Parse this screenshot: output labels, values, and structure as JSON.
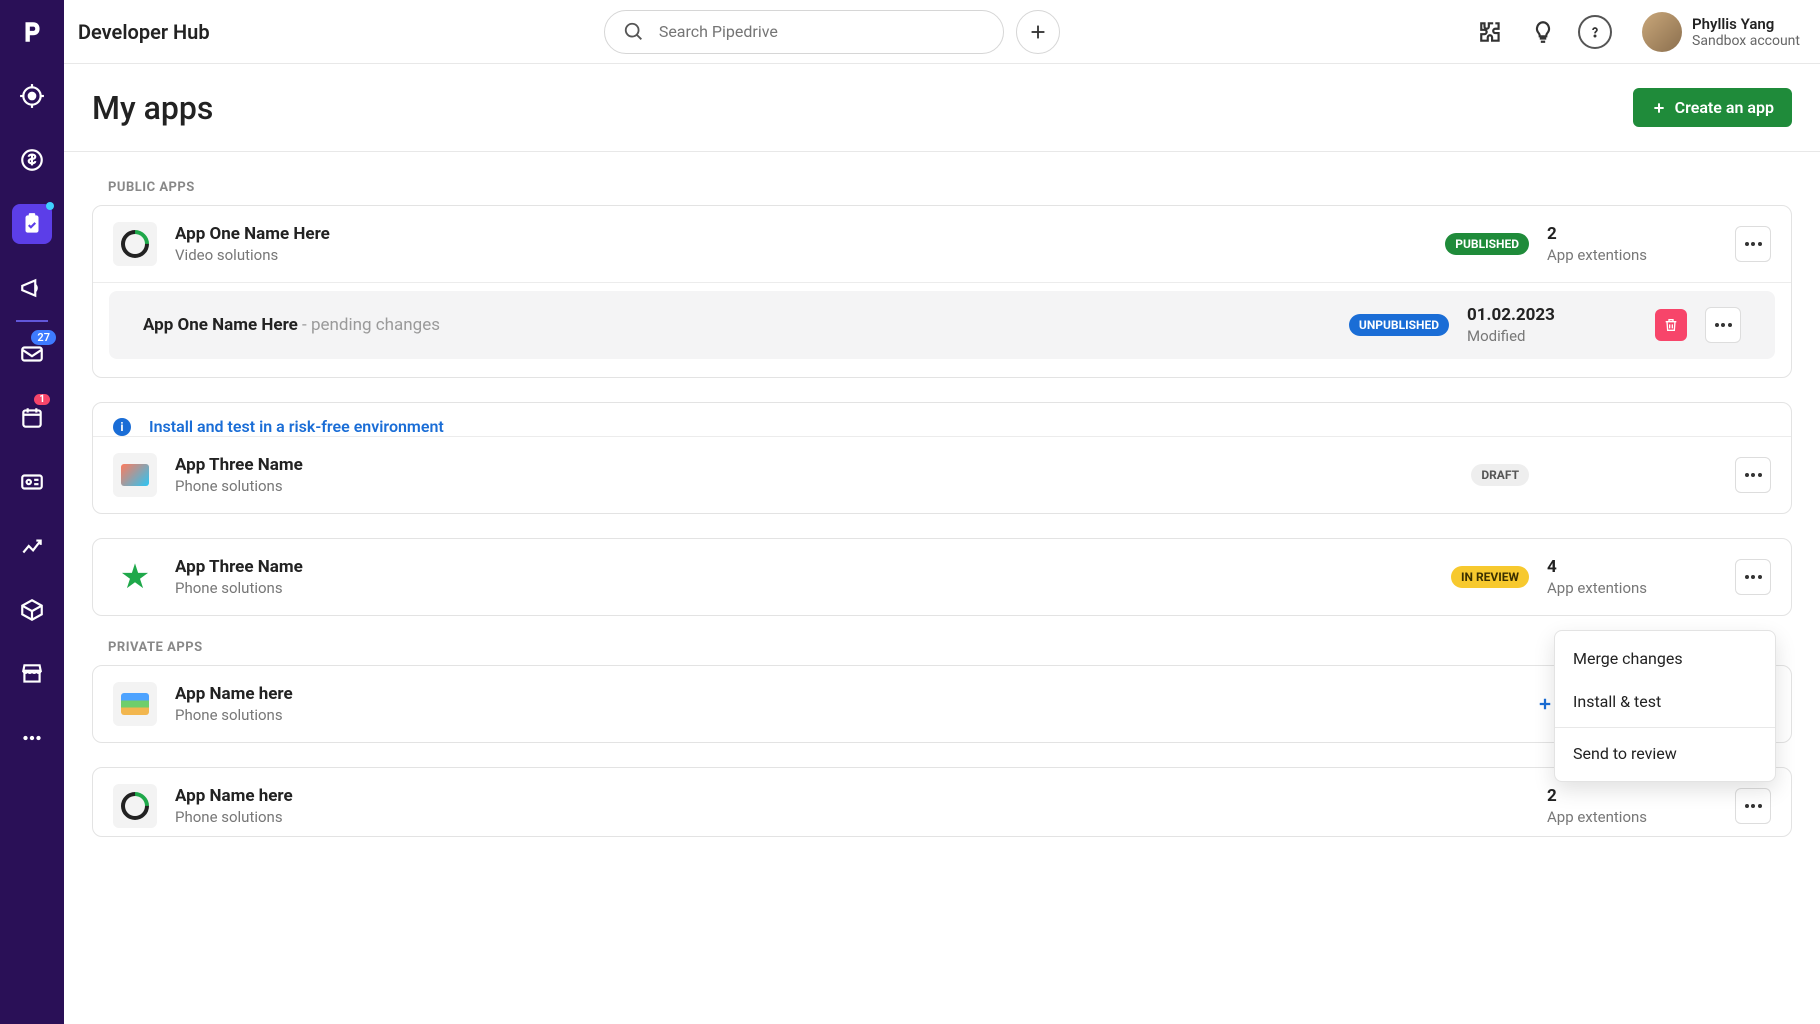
{
  "brand": "Developer Hub",
  "search": {
    "placeholder": "Search Pipedrive"
  },
  "user": {
    "name": "Phyllis Yang",
    "account": "Sandbox account"
  },
  "sidebar": {
    "mail_badge": "27",
    "activity_badge": "1"
  },
  "page": {
    "title": "My apps",
    "create_label": "Create an app"
  },
  "sections": {
    "public_label": "PUBLIC APPS",
    "private_label": "PRIVATE APPS"
  },
  "apps": {
    "a1": {
      "name": "App One Name Here",
      "desc": "Video solutions",
      "status": "PUBLISHED",
      "meta_top": "2",
      "meta_bottom": "App extentions"
    },
    "a1_pending": {
      "name": "App One Name Here",
      "suffix": " - pending changes",
      "status": "UNPUBLISHED",
      "meta_top": "01.02.2023",
      "meta_bottom": "Modified"
    },
    "info_link": "Install and test in a risk-free environment",
    "a3": {
      "name": "App Three Name",
      "desc": "Phone solutions",
      "status": "DRAFT"
    },
    "a4": {
      "name": "App Three Name",
      "desc": "Phone solutions",
      "status": "IN REVIEW",
      "meta_top": "4",
      "meta_bottom": "App extentions"
    },
    "p1": {
      "name": "App Name here",
      "desc": "Phone solutions",
      "add_ext": "Add extentions"
    },
    "p2": {
      "name": "App Name here",
      "desc": "Phone solutions",
      "meta_top": "2",
      "meta_bottom": "App extentions"
    }
  },
  "dropdown": {
    "merge": "Merge changes",
    "install": "Install & test",
    "review": "Send to review"
  }
}
